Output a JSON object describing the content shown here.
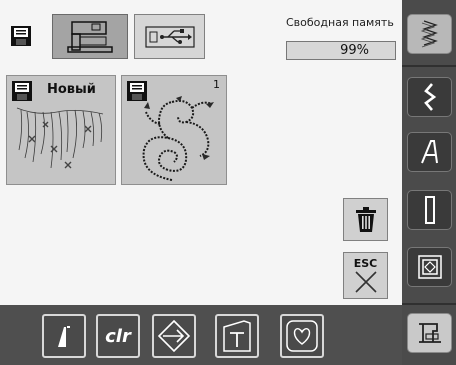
{
  "memory": {
    "title": "Свободная память",
    "value": "99%"
  },
  "cards": [
    {
      "label": "Новый",
      "number": ""
    },
    {
      "label": "",
      "number": "1"
    }
  ],
  "buttons": {
    "esc_label": "ESC",
    "clr_label": "clr"
  },
  "icons": {
    "top": [
      "floppy-icon",
      "machine-memory-icon",
      "usb-icon"
    ],
    "right": [
      "stitch-icon",
      "zigzag-icon",
      "alphabet-icon",
      "buttonhole-icon",
      "quilt-icon",
      "embroidery-machine-icon"
    ],
    "bottom": [
      "needle-stop-icon",
      "clr-icon",
      "rotate-icon",
      "hoop-icon",
      "heart-icon"
    ],
    "action": [
      "trash-icon",
      "esc-icon"
    ]
  },
  "colors": {
    "rail": "#4b4b4b",
    "bottom": "#4f4f4f",
    "selected_tab": "#a4a4a4",
    "card": "#c5c5c5"
  }
}
